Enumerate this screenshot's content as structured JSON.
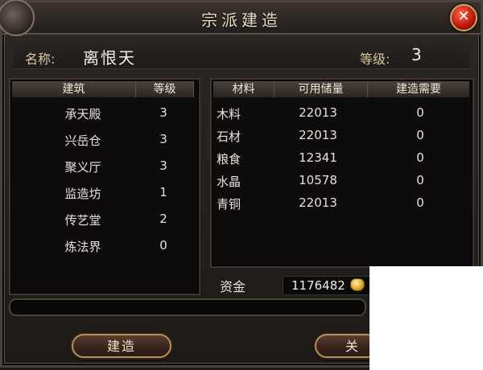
{
  "window": {
    "title": "宗派建造"
  },
  "info": {
    "name_label": "名称:",
    "name_value": "离恨天",
    "level_label": "等级:",
    "level_value": "3"
  },
  "buildings": {
    "headers": [
      "建筑",
      "等级"
    ],
    "rows": [
      [
        "承天殿",
        "3"
      ],
      [
        "兴岳仓",
        "3"
      ],
      [
        "聚义厅",
        "3"
      ],
      [
        "监造坊",
        "1"
      ],
      [
        "传艺堂",
        "2"
      ],
      [
        "炼法界",
        "0"
      ]
    ]
  },
  "materials": {
    "headers": [
      "材料",
      "可用储量",
      "建造需要"
    ],
    "rows": [
      [
        "木料",
        "22013",
        "0"
      ],
      [
        "石材",
        "22013",
        "0"
      ],
      [
        "粮食",
        "12341",
        "0"
      ],
      [
        "水晶",
        "10578",
        "0"
      ],
      [
        "青铜",
        "22013",
        "0"
      ]
    ]
  },
  "funds": {
    "label": "资金",
    "value": "1176482"
  },
  "buttons": {
    "build": "建造",
    "close": "关"
  },
  "icons": {
    "close": "close-icon",
    "coin": "gold-coin-icon"
  },
  "colors": {
    "accent": "#b88f55",
    "close_red": "#b8120a"
  },
  "progress": {
    "value": 0
  }
}
